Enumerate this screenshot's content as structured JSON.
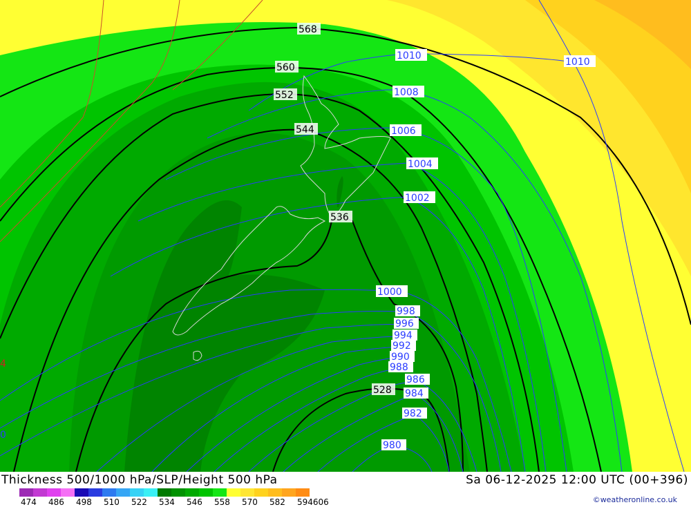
{
  "title": "Thickness 500/1000 hPa/SLP/Height 500 hPa",
  "valid_time": "Sa 06-12-2025 12:00 UTC (00+396)",
  "credit": "©weatheronline.co.uk",
  "legend": {
    "labels": [
      "474",
      "486",
      "498",
      "510",
      "522",
      "534",
      "546",
      "558",
      "570",
      "582",
      "594606"
    ],
    "colors": [
      "#9c2ab4",
      "#c23ad2",
      "#e040ef",
      "#f570f5",
      "#1a0ab5",
      "#2a3ce0",
      "#2d7af0",
      "#36a6f5",
      "#36d2f5",
      "#3af0f5",
      "#007a00",
      "#009200",
      "#00aa00",
      "#00c400",
      "#14e614",
      "#ffff33",
      "#ffe633",
      "#ffd21e",
      "#ffbd1e",
      "#ffa51e",
      "#ff8c14"
    ]
  },
  "height_labels": [
    "568",
    "560",
    "552",
    "544",
    "536",
    "528"
  ],
  "pressure_labels": [
    "1010",
    "1010",
    "1008",
    "1006",
    "1004",
    "1002",
    "1000",
    "998",
    "996",
    "994",
    "992",
    "990",
    "988",
    "986",
    "984",
    "982",
    "980"
  ],
  "edge_labels": [
    "4",
    "0"
  ]
}
